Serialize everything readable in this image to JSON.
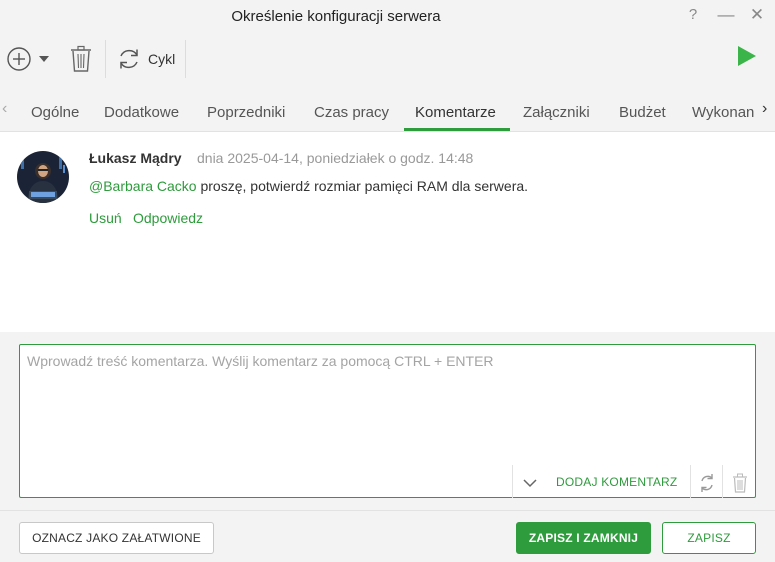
{
  "window": {
    "title": "Określenie konfiguracji serwera",
    "help_label": "?",
    "minimize_label": "—",
    "close_label": "✕"
  },
  "toolbar": {
    "cycle_label": "Cykl"
  },
  "tabs": [
    {
      "label": "Ogólne"
    },
    {
      "label": "Dodatkowe"
    },
    {
      "label": "Poprzedniki"
    },
    {
      "label": "Czas pracy"
    },
    {
      "label": "Komentarze",
      "active": true
    },
    {
      "label": "Załączniki"
    },
    {
      "label": "Budżet"
    },
    {
      "label": "Wykonan"
    }
  ],
  "comment": {
    "author": "Łukasz Mądry",
    "date": "dnia 2025-04-14, poniedziałek o godz. 14:48",
    "mention": "@Barbara Cacko",
    "text": " proszę, potwierdź rozmiar pamięci RAM dla serwera.",
    "delete_label": "Usuń",
    "reply_label": "Odpowiedz"
  },
  "editor": {
    "placeholder": "Wprowadź treść komentarza. Wyślij komentarz za pomocą CTRL + ENTER",
    "value": "",
    "add_label": "DODAJ KOMENTARZ"
  },
  "footer": {
    "resolve_label": "OZNACZ JAKO ZAŁATWIONE",
    "save_close_label": "ZAPISZ I ZAMKNIJ",
    "save_label": "ZAPISZ"
  },
  "colors": {
    "accent": "#2e9b3c",
    "chrome": "#f3f3f3"
  }
}
